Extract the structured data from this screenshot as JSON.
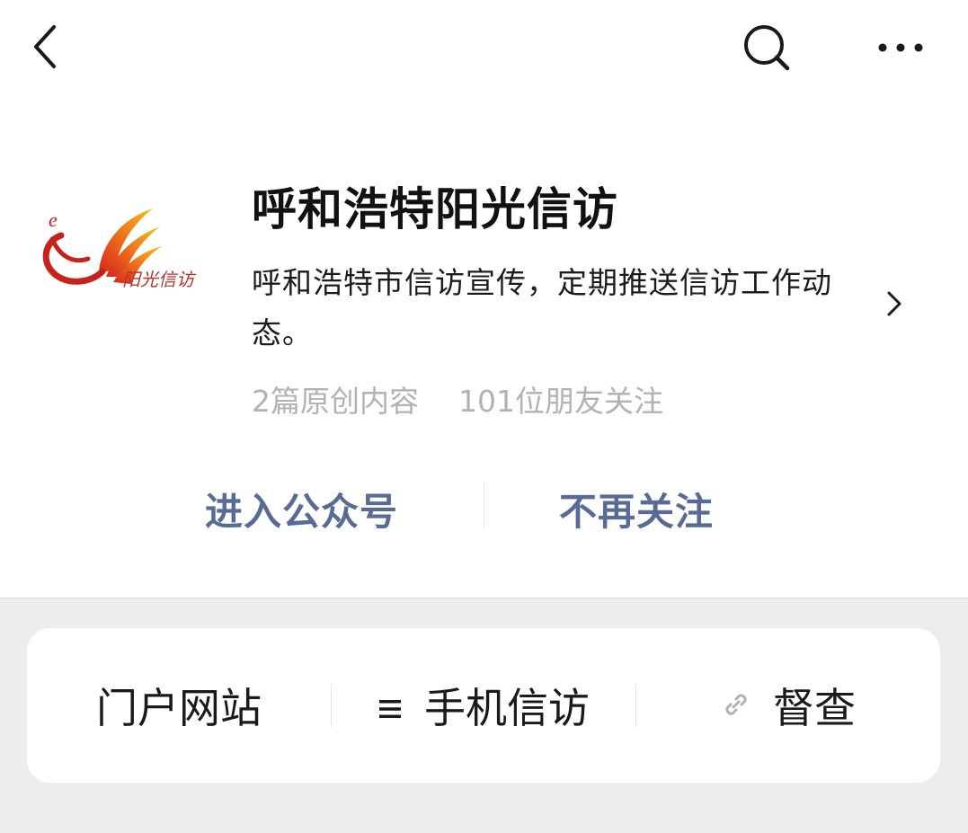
{
  "nav": {
    "back_icon": "chevron-left-icon",
    "search_icon": "search-icon",
    "more_icon": "more-horizontal-icon"
  },
  "account": {
    "logo_icon": "sunshine-petition-logo",
    "logo_caption": "阳光信访",
    "name": "呼和浩特阳光信访",
    "description": "呼和浩特市信访宣传，定期推送信访工作动态。",
    "original_count": "2篇原创内容",
    "followers": "101位朋友关注"
  },
  "actions": {
    "enter_label": "进入公众号",
    "unfollow_label": "不再关注"
  },
  "menu": [
    {
      "label": "门户网站",
      "icon": ""
    },
    {
      "label": "手机信访",
      "icon": "menu-lines-icon"
    },
    {
      "label": "督查",
      "icon": "link-icon"
    }
  ],
  "colors": {
    "link_blue": "#576b95",
    "stats_gray": "#b2b2b2",
    "background": "#ededed"
  }
}
